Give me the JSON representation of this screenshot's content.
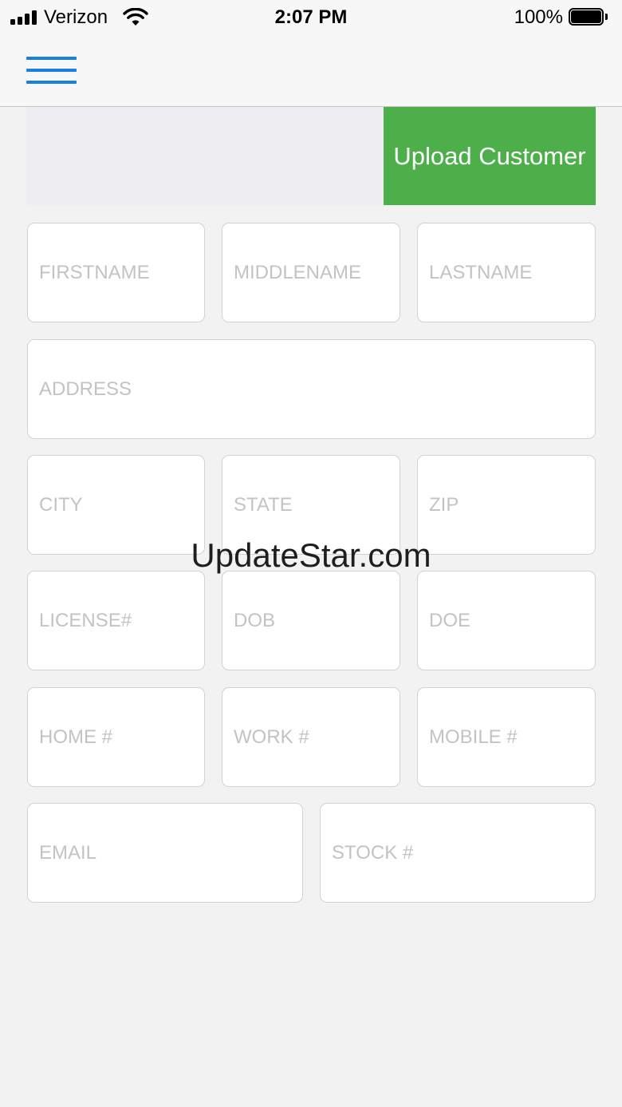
{
  "status_bar": {
    "carrier": "Verizon",
    "time": "2:07 PM",
    "battery_percent": "100%",
    "battery_level": 1.0,
    "signal_bars": 4
  },
  "nav": {
    "menu_icon": "hamburger-menu-icon",
    "accent_color": "#1a7fe0"
  },
  "header": {
    "upload_label": "Upload Customer",
    "upload_color": "#4caf4a"
  },
  "form": {
    "firstname": {
      "placeholder": "FIRSTNAME",
      "value": ""
    },
    "middlename": {
      "placeholder": "MIDDLENAME",
      "value": ""
    },
    "lastname": {
      "placeholder": "LASTNAME",
      "value": ""
    },
    "address": {
      "placeholder": "ADDRESS",
      "value": ""
    },
    "city": {
      "placeholder": "CITY",
      "value": ""
    },
    "state": {
      "placeholder": "STATE",
      "value": ""
    },
    "zip": {
      "placeholder": "ZIP",
      "value": ""
    },
    "license": {
      "placeholder": "LICENSE#",
      "value": ""
    },
    "dob": {
      "placeholder": "DOB",
      "value": ""
    },
    "doe": {
      "placeholder": "DOE",
      "value": ""
    },
    "home_phone": {
      "placeholder": "HOME #",
      "value": ""
    },
    "work_phone": {
      "placeholder": "WORK #",
      "value": ""
    },
    "mobile_phone": {
      "placeholder": "MOBILE #",
      "value": ""
    },
    "email": {
      "placeholder": "EMAIL",
      "value": ""
    },
    "stock": {
      "placeholder": "STOCK #",
      "value": ""
    }
  },
  "watermark": "UpdateStar.com"
}
